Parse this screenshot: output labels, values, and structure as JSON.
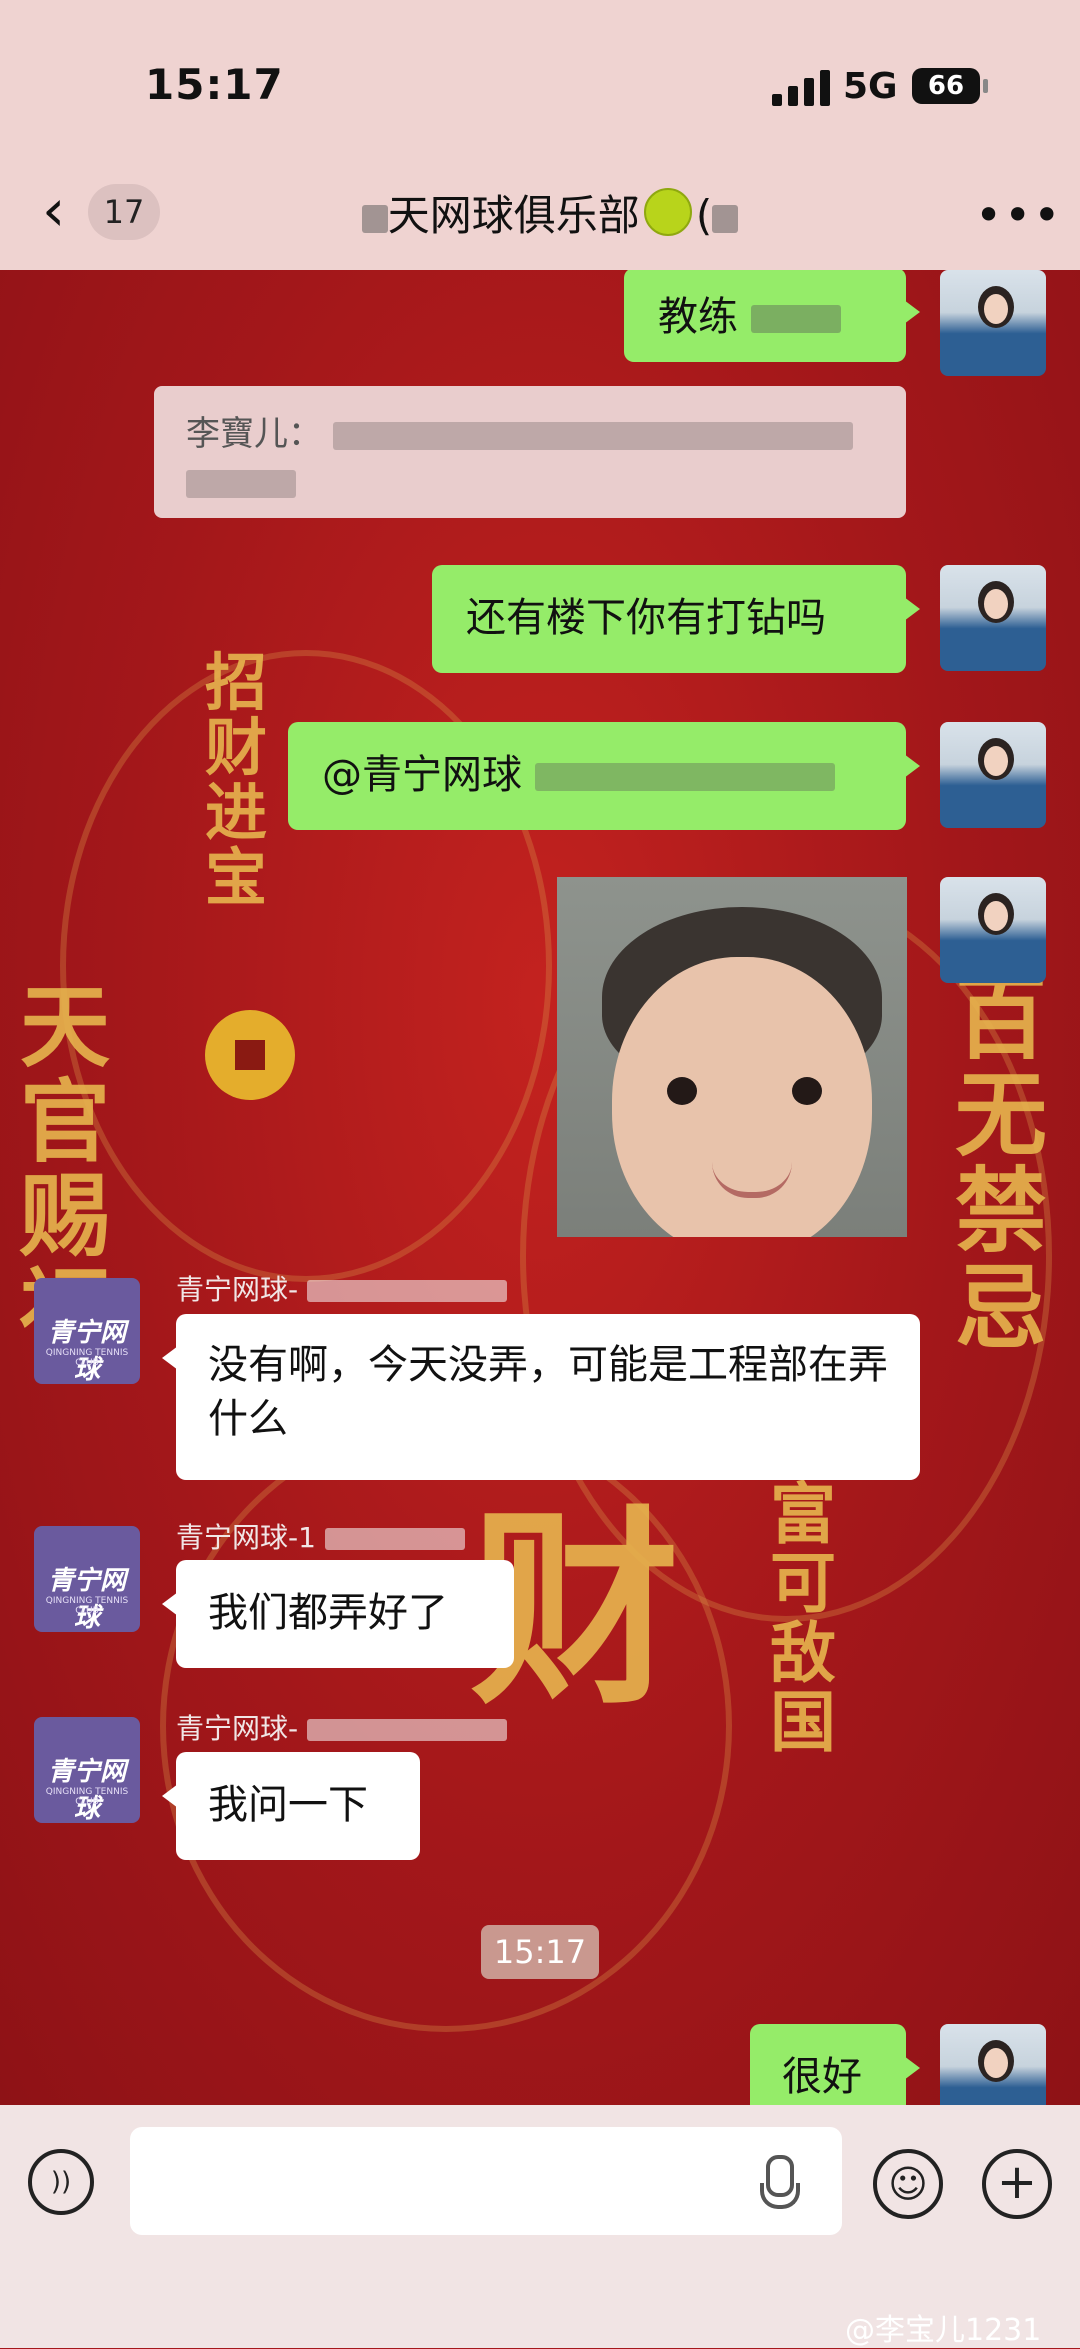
{
  "status": {
    "time": "15:17",
    "network": "5G",
    "battery": "66"
  },
  "nav": {
    "back_count": "17",
    "title_left": "天网球俱乐部",
    "title_right": "(",
    "more": "•••"
  },
  "messages": {
    "m1": "教练",
    "quote_author": "李寶儿：",
    "m2": "还有楼下你有打钻吗",
    "m3": "@青宁网球",
    "sender1": "青宁网球-",
    "r1": "没有啊，今天没弄，可能是工程部在弄什么",
    "sender2": "青宁网球-1",
    "r2": "我们都弄好了",
    "sender3": "青宁网球-",
    "r3": "我问一下",
    "timestamp": "15:17",
    "m4": "很好"
  },
  "club_logo": {
    "name": "青宁网球",
    "sub": "QINGNING TENNIS CLUB"
  },
  "background_text": [
    "招财进宝",
    "天官赐福",
    "百无禁忌",
    "富可敌国",
    "财"
  ],
  "watermark": "@李宝儿1231",
  "colors": {
    "my_bubble": "#95ec69",
    "their_bubble": "#ffffff",
    "bar": "#efd3d1",
    "bg": "#a5161a"
  }
}
